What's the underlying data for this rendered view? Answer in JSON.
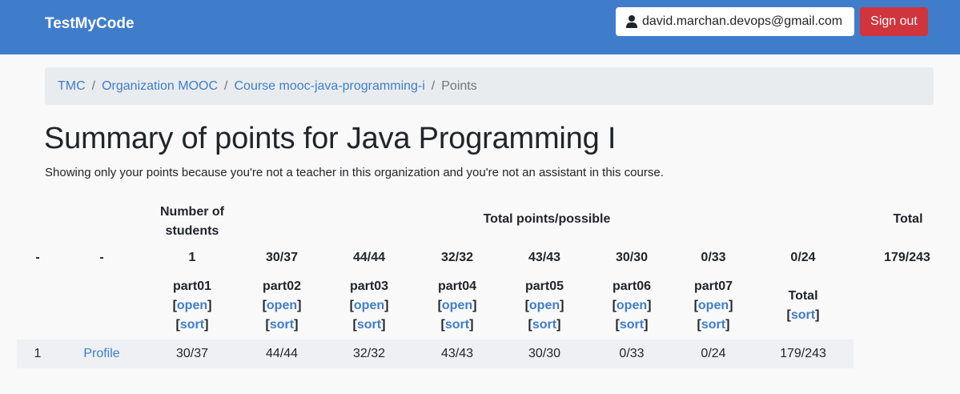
{
  "navbar": {
    "brand": "TestMyCode",
    "user_email": "david.marchan.devops@gmail.com",
    "signout_label": "Sign out"
  },
  "breadcrumb": [
    "TMC",
    "Organization MOOC",
    "Course mooc-java-programming-i",
    "Points"
  ],
  "title": "Summary of points for Java Programming I",
  "note": "Showing only your points because you're not a teacher in this organization and you're not an assistant in this course.",
  "table": {
    "header_students": "Number of students",
    "header_total_possible": "Total points/possible",
    "header_total": "Total",
    "summary_row": [
      "-",
      "-",
      "1",
      "30/37",
      "44/44",
      "32/32",
      "43/43",
      "30/30",
      "0/33",
      "0/24",
      "179/243"
    ],
    "columns": [
      "part01",
      "part02",
      "part03",
      "part04",
      "part05",
      "part06",
      "part07"
    ],
    "open_label": "open",
    "sort_label": "sort",
    "total_col": "Total",
    "data_row": {
      "rank": "1",
      "profile": "Profile",
      "values": [
        "30/37",
        "44/44",
        "32/32",
        "43/43",
        "30/30",
        "0/33",
        "0/24",
        "179/243"
      ]
    }
  }
}
